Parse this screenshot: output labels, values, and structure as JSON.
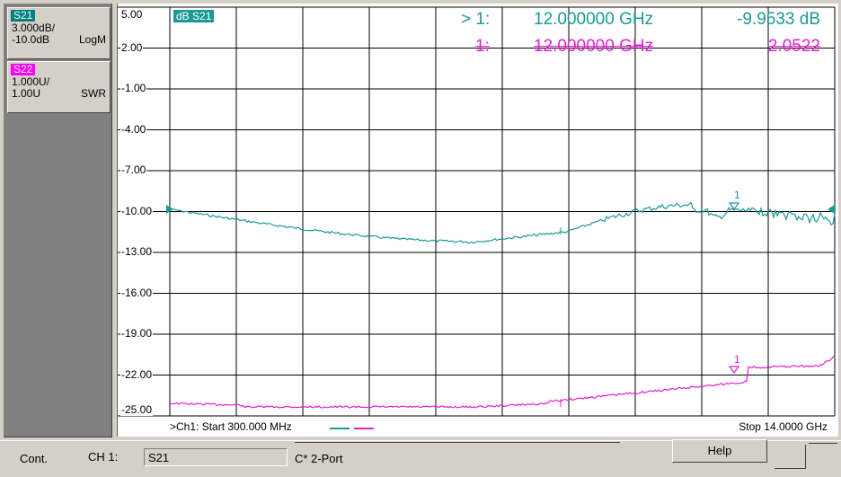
{
  "traces": [
    {
      "tag": "S21",
      "scale": "3.000dB/",
      "ref": "-10.0dB",
      "format": "LogM",
      "tag_bg": "#008080",
      "tag_color": "#ffffff"
    },
    {
      "tag": "S22",
      "scale": "1.000U/",
      "ref": "1.00U",
      "format": "SWR",
      "tag_bg": "#ff00ff",
      "tag_color": "#ffffff"
    }
  ],
  "plot": {
    "trace_label": "dB S21",
    "y_ticks": [
      "5.00",
      "2.00",
      "-1.00",
      "-4.00",
      "-7.00",
      "-10.00",
      "-13.00",
      "-16.00",
      "-19.00",
      "-22.00",
      "-25.00"
    ],
    "start_label": ">Ch1: Start  300.000 MHz",
    "stop_label": "Stop  14.0000 GHz",
    "marker_label": "1"
  },
  "markers": {
    "s21": {
      "prefix": "> 1:",
      "freq": "12.000000 GHz",
      "value": "-9.9533 dB"
    },
    "s22": {
      "prefix": "1:",
      "freq": "12.000000 GHz",
      "value": "2.0522"
    }
  },
  "colors": {
    "s21": "#1a9a96",
    "s22": "#e020d0",
    "grid": "#000000"
  },
  "status": {
    "mode": "Cont.",
    "channel": "CH 1:",
    "measurement": "S21",
    "cal": "C* 2-Port",
    "help": "Help"
  }
}
